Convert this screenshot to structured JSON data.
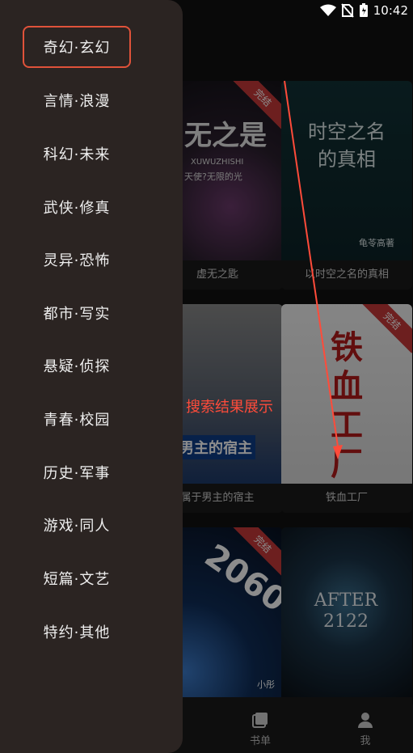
{
  "status": {
    "time": "10:42"
  },
  "books": [
    {
      "title": "虚无之匙",
      "cover_text": "无之是",
      "cover_sub": "XUWUZHISHI",
      "cover_sub2": "天使?无限的光",
      "badge": "完结"
    },
    {
      "title": "以时空之名的真相",
      "cover_text": "时空之名的真相",
      "cover_author": "龟苓高著"
    },
    {
      "title": "属于男主的宿主",
      "cover_text": "男主的宿主"
    },
    {
      "title": "铁血工厂",
      "cover_text": "铁血工厂",
      "badge": "完结"
    },
    {
      "title": "",
      "cover_text": "2060",
      "cover_author": "小彤",
      "badge": "完结"
    },
    {
      "title": "",
      "cover_text": "AFTER 2122"
    }
  ],
  "bottom_tabs": [
    {
      "label": "书单",
      "icon": "bookshelf-icon"
    },
    {
      "label": "我",
      "icon": "person-icon"
    }
  ],
  "drawer": {
    "items": [
      {
        "label": "奇幻·玄幻"
      },
      {
        "label": "言情·浪漫"
      },
      {
        "label": "科幻·未来"
      },
      {
        "label": "武侠·修真"
      },
      {
        "label": "灵异·恐怖"
      },
      {
        "label": "都市·写实"
      },
      {
        "label": "悬疑·侦探"
      },
      {
        "label": "青春·校园"
      },
      {
        "label": "历史·军事"
      },
      {
        "label": "游戏·同人"
      },
      {
        "label": "短篇·文艺"
      },
      {
        "label": "特约·其他"
      }
    ]
  },
  "annotation": {
    "label": "搜索结果展示"
  },
  "colors": {
    "accent": "#e0523a",
    "drawer_bg": "#2b2422",
    "ribbon": "#c73a3a"
  }
}
